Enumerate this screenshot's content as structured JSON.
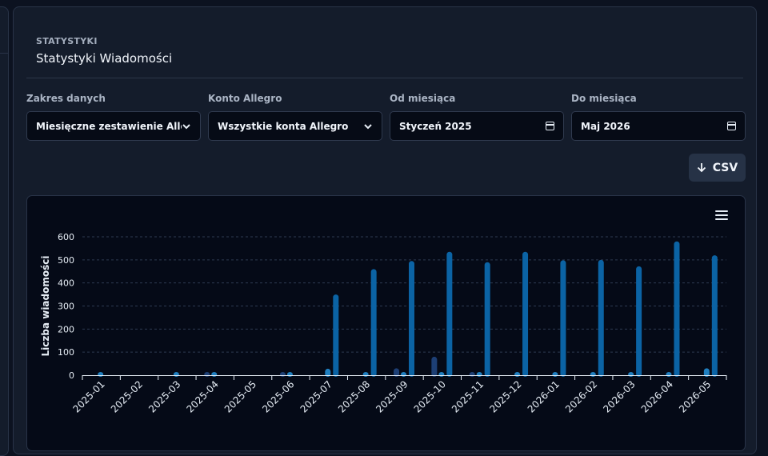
{
  "page": {
    "eyebrow": "STATYSTYKI",
    "title": "Statystyki Wiadomości"
  },
  "filters": {
    "range": {
      "label": "Zakres danych",
      "value": "Miesięczne zestawienie Allegro"
    },
    "account": {
      "label": "Konto Allegro",
      "value": "Wszystkie konta Allegro"
    },
    "from": {
      "label": "Od miesiąca",
      "value": "Styczeń 2025"
    },
    "to": {
      "label": "Do miesiąca",
      "value": "Maj 2026"
    }
  },
  "toolbar": {
    "csv_label": "CSV",
    "csv_icon": "arrow-down-icon"
  },
  "chart_data": {
    "type": "bar",
    "ylabel": "Liczba wiadomości",
    "ylim": [
      0,
      600
    ],
    "yticks": [
      0,
      100,
      200,
      300,
      400,
      500,
      600
    ],
    "grid": true,
    "categories": [
      "2025-01",
      "2025-02",
      "2025-03",
      "2025-04",
      "2025-05",
      "2025-06",
      "2025-07",
      "2025-08",
      "2025-09",
      "2025-10",
      "2025-11",
      "2025-12",
      "2026-01",
      "2026-02",
      "2026-03",
      "2026-04",
      "2026-05"
    ],
    "series": [
      {
        "color": "#1d3f75",
        "values": [
          0,
          0,
          0,
          2,
          0,
          5,
          0,
          0,
          30,
          80,
          8,
          0,
          0,
          0,
          0,
          0,
          0
        ]
      },
      {
        "color": "#1f7fc0",
        "values": [
          8,
          0,
          10,
          3,
          0,
          12,
          28,
          3,
          5,
          5,
          5,
          3,
          2,
          8,
          8,
          10,
          30
        ]
      },
      {
        "color": "#0b63a4",
        "values": [
          0,
          0,
          0,
          0,
          0,
          0,
          350,
          460,
          495,
          535,
          490,
          535,
          498,
          500,
          472,
          580,
          520
        ]
      }
    ],
    "colors": {
      "axis": "#e6edf5",
      "grid": "#2d3a52",
      "tick_text": "#e6edf5"
    }
  }
}
